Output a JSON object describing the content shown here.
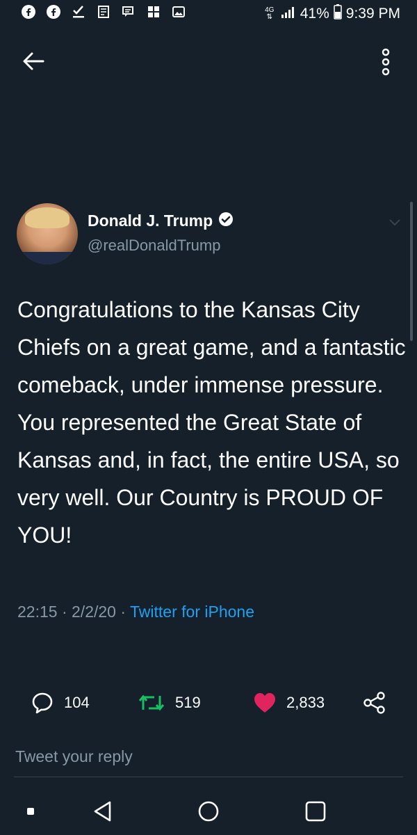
{
  "status_bar": {
    "network": "4G",
    "battery": "41%",
    "time": "9:39 PM",
    "left_icons": [
      "facebook-icon",
      "facebook-icon",
      "download-check-icon",
      "news-icon",
      "chat-icon",
      "tiles-icon",
      "image-icon"
    ]
  },
  "tweet": {
    "display_name": "Donald J. Trump",
    "handle": "@realDonaldTrump",
    "text": "Congratulations to the Kansas City Chiefs on a great game, and a fantastic comeback, under immense pressure. You represented the Great State of Kansas and, in fact, the entire USA, so very well. Our Country is PROUD OF YOU!",
    "time": "22:15",
    "date": "2/2/20",
    "separator": "·",
    "source": "Twitter for iPhone"
  },
  "actions": {
    "replies": "104",
    "retweets": "519",
    "likes": "2,833"
  },
  "reply": {
    "placeholder": "Tweet your reply"
  },
  "colors": {
    "background": "#15202b",
    "link": "#1da1f2",
    "retweet": "#17bf63",
    "like": "#e0245e",
    "muted": "#8899a6"
  }
}
